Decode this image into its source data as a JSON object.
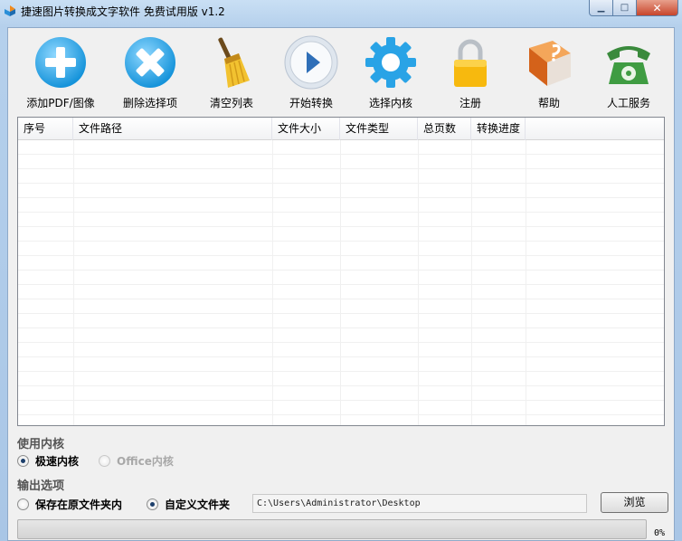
{
  "window": {
    "title": "捷速图片转换成文字软件 免费试用版 v1.2",
    "minimize_glyph": "▁",
    "maximize_glyph": "□",
    "close_glyph": "✕"
  },
  "toolbar": {
    "items": [
      {
        "label": "添加PDF/图像",
        "icon": "add-icon"
      },
      {
        "label": "删除选择项",
        "icon": "delete-icon"
      },
      {
        "label": "清空列表",
        "icon": "broom-icon"
      },
      {
        "label": "开始转换",
        "icon": "play-icon"
      },
      {
        "label": "选择内核",
        "icon": "gear-icon"
      },
      {
        "label": "注册",
        "icon": "lock-icon"
      },
      {
        "label": "帮助",
        "icon": "help-book-icon"
      },
      {
        "label": "人工服务",
        "icon": "telephone-icon"
      }
    ]
  },
  "file_list": {
    "columns": [
      "序号",
      "文件路径",
      "文件大小",
      "文件类型",
      "总页数",
      "转换进度"
    ],
    "rows": []
  },
  "engine": {
    "section_label": "使用内核",
    "options": [
      {
        "label": "极速内核",
        "selected": true,
        "enabled": true
      },
      {
        "label": "Office内核",
        "selected": false,
        "enabled": false
      }
    ]
  },
  "output": {
    "section_label": "输出选项",
    "options": [
      {
        "label": "保存在原文件夹内",
        "selected": false
      },
      {
        "label": "自定义文件夹",
        "selected": true
      }
    ],
    "path_value": "C:\\Users\\Administrator\\Desktop",
    "browse_label": "浏览"
  },
  "progress": {
    "percent": 0,
    "text": "0%"
  },
  "colors": {
    "accent_blue": "#29a3e6",
    "progress_green": "#3cb24b"
  }
}
